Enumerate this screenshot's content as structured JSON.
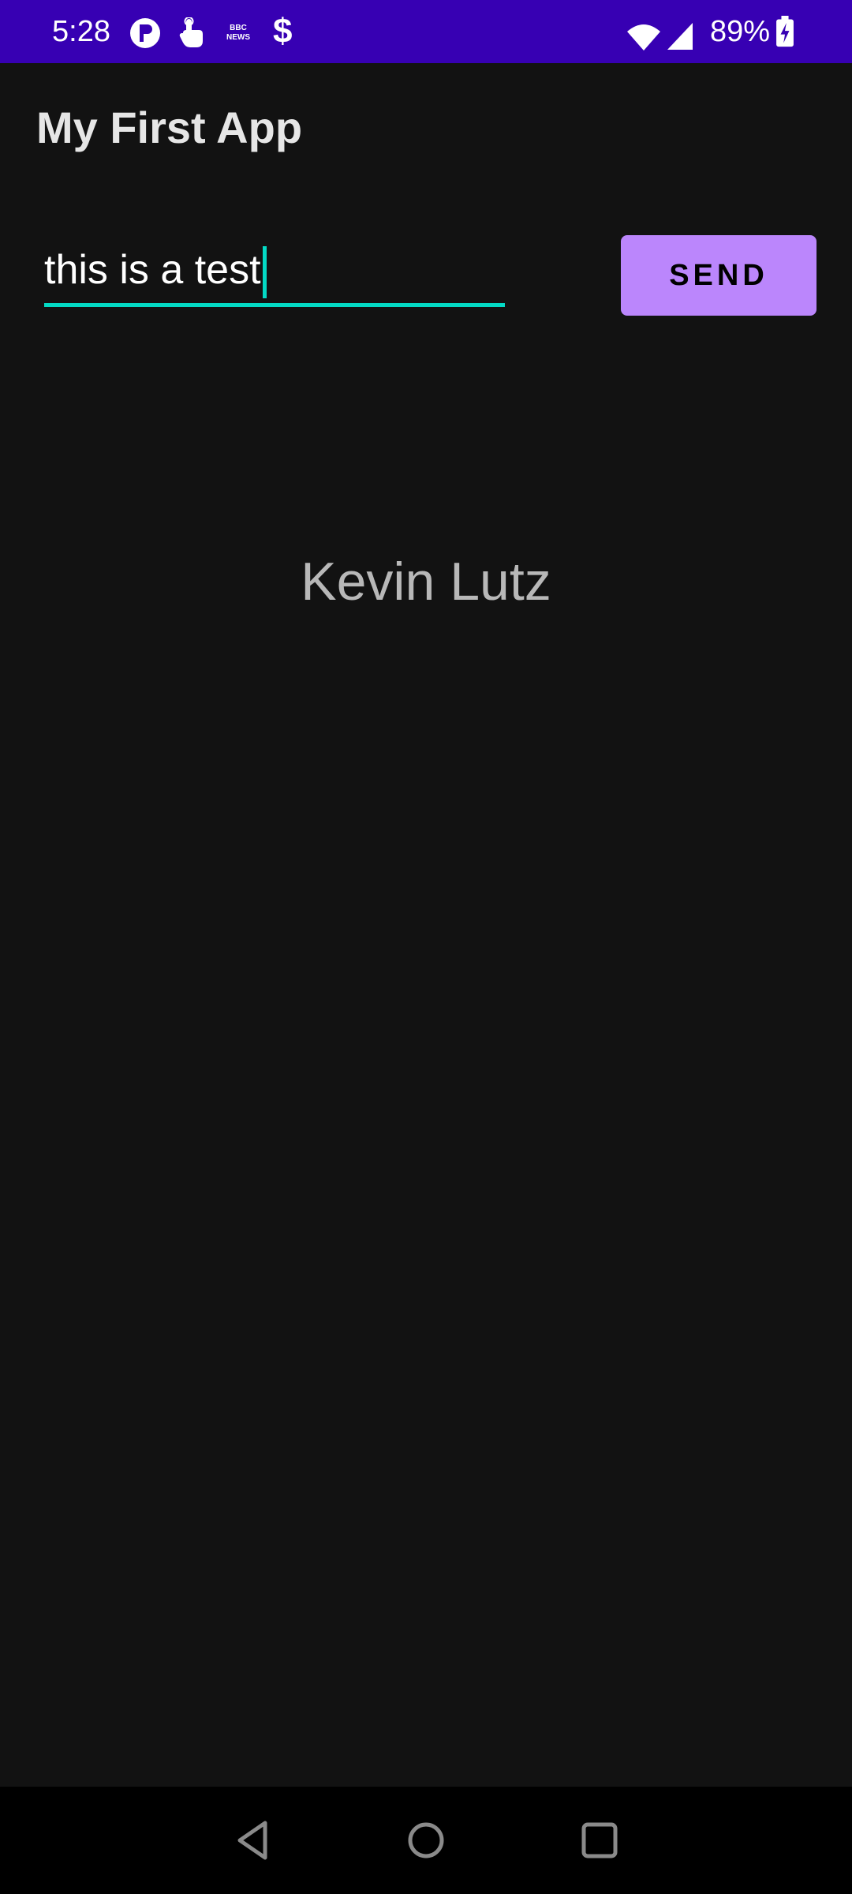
{
  "status_bar": {
    "time": "5:28",
    "battery_percent": "89%",
    "background_color": "#3700b3",
    "notification_icons": [
      "circle-p-icon",
      "hand-touch-icon",
      "bbc-news-icon",
      "dollar-icon"
    ],
    "bbc_news_text": "BBC NEWS",
    "dollar_glyph": "$",
    "system_icons": [
      "wifi-icon",
      "cellular-signal-icon",
      "battery-charging-icon"
    ]
  },
  "app": {
    "title": "My First App"
  },
  "message_input": {
    "value": "this is a test",
    "accent_color": "#03dac5"
  },
  "send_button": {
    "label": "SEND",
    "color": "#bb86fc"
  },
  "display": {
    "text": "Kevin Lutz"
  },
  "nav_bar": {
    "buttons": [
      "back-icon",
      "home-icon",
      "recents-icon"
    ]
  }
}
